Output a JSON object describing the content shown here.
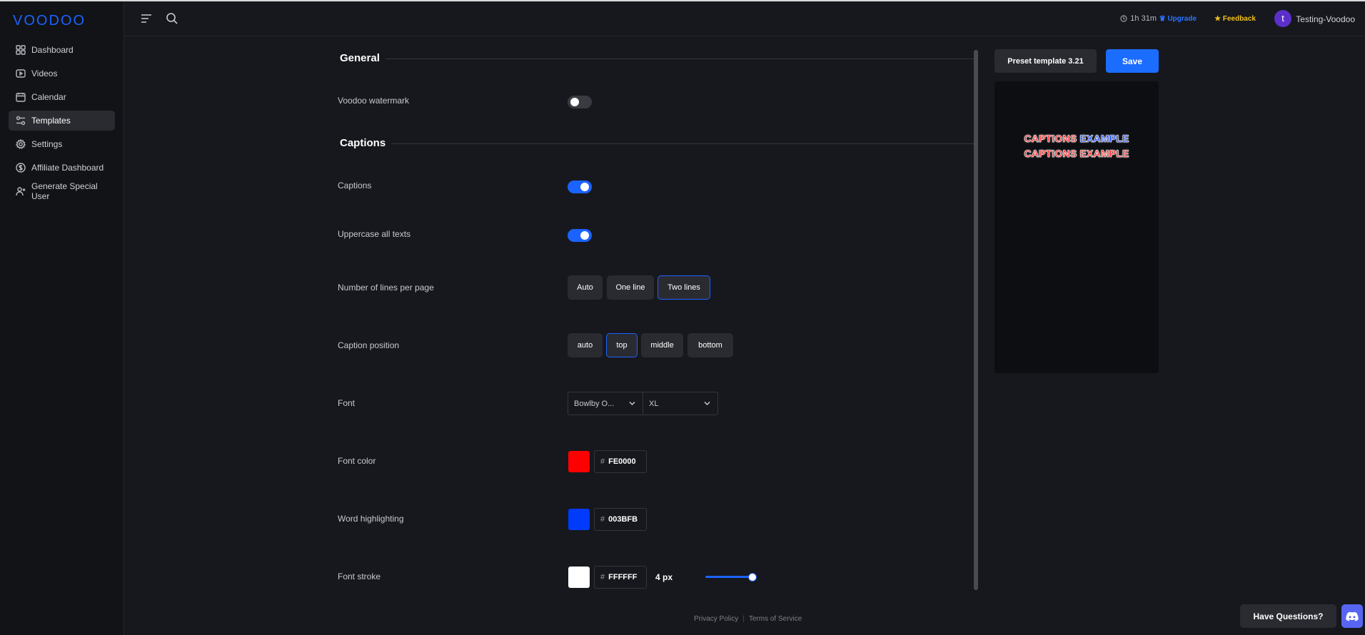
{
  "app": {
    "logo": "VOODOO"
  },
  "sidebar": {
    "items": [
      {
        "label": "Dashboard",
        "icon": "grid-icon"
      },
      {
        "label": "Videos",
        "icon": "play-icon"
      },
      {
        "label": "Calendar",
        "icon": "calendar-icon"
      },
      {
        "label": "Templates",
        "icon": "templates-icon",
        "active": true
      },
      {
        "label": "Settings",
        "icon": "gear-icon"
      },
      {
        "label": "Affiliate Dashboard",
        "icon": "dollar-icon"
      },
      {
        "label": "Generate Special User",
        "icon": "user-plus-icon"
      }
    ]
  },
  "topbar": {
    "time_remaining": "1h 31m",
    "upgrade": "Upgrade",
    "feedback": "Feedback",
    "avatar_letter": "t",
    "username": "Testing-Voodoo"
  },
  "general": {
    "title": "General",
    "watermark_label": "Voodoo watermark",
    "watermark_on": false
  },
  "captions": {
    "title": "Captions",
    "captions_label": "Captions",
    "captions_on": true,
    "uppercase_label": "Uppercase all texts",
    "uppercase_on": true,
    "lines_label": "Number of lines per page",
    "lines_options": [
      "Auto",
      "One line",
      "Two lines"
    ],
    "lines_selected": "Two lines",
    "position_label": "Caption position",
    "position_options": [
      "auto",
      "top",
      "middle",
      "bottom"
    ],
    "position_selected": "top",
    "font_label": "Font",
    "font_family": "Bowlby O...",
    "font_size": "XL",
    "font_color_label": "Font color",
    "font_color_hex": "FE0000",
    "font_color": "#FE0000",
    "highlight_label": "Word highlighting",
    "highlight_hex": "003BFB",
    "highlight_color": "#003BFB",
    "stroke_label": "Font stroke",
    "stroke_hex": "FFFFFF",
    "stroke_color": "#FFFFFF",
    "stroke_width": "4 px"
  },
  "preview": {
    "preset_button": "Preset template 3.21",
    "save_button": "Save",
    "caption_word_1": "CAPTIONS",
    "caption_word_2": "EXAMPLE"
  },
  "footer": {
    "privacy": "Privacy Policy",
    "terms": "Terms of Service",
    "questions": "Have Questions?"
  }
}
